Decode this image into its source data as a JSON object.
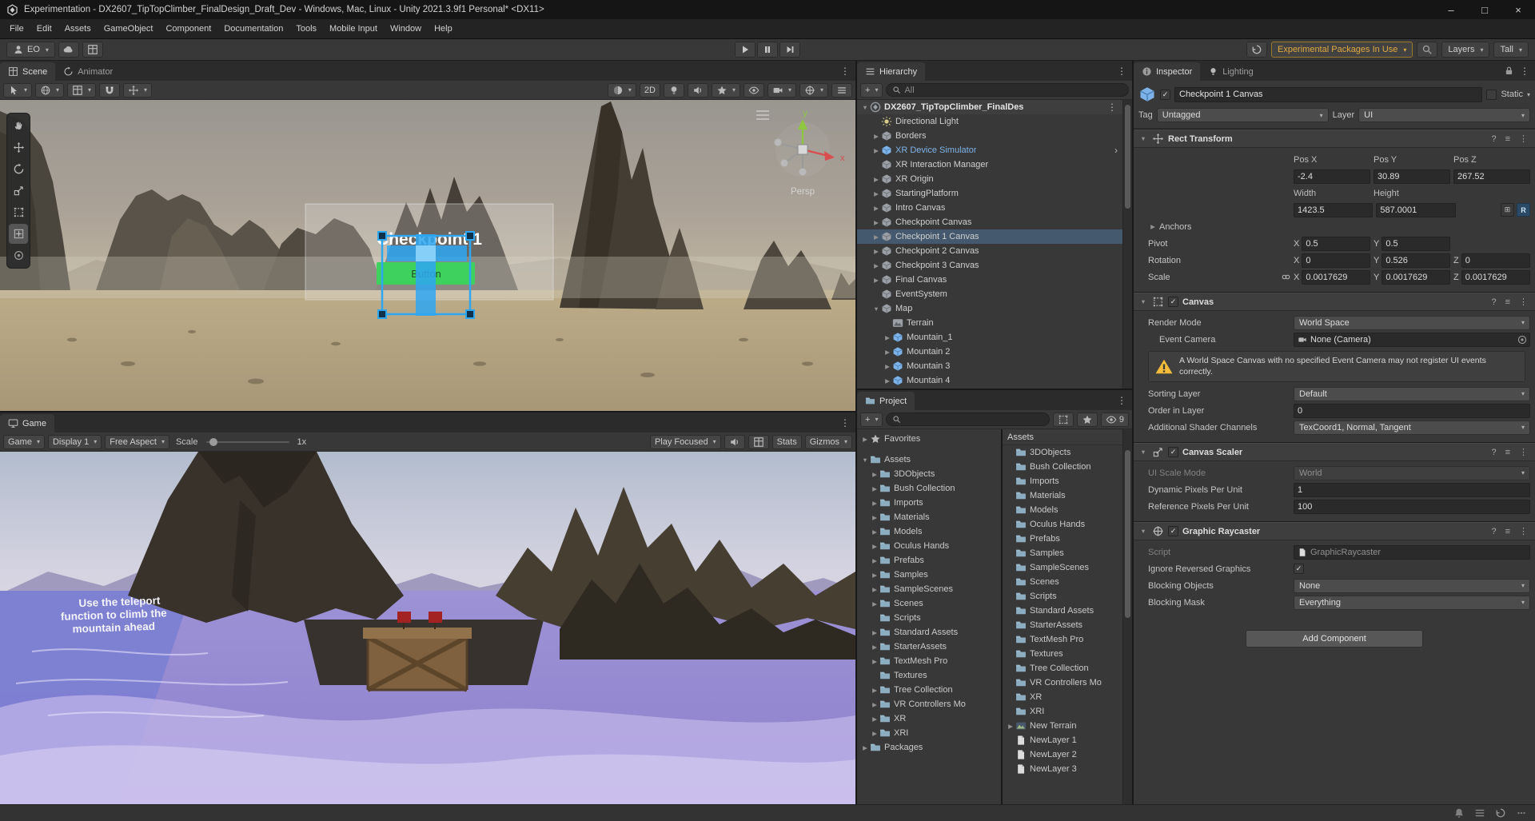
{
  "colors": {
    "selection_blue": "#44596E",
    "prefab_text": "#7FB3E8",
    "warning_yellow": "#F4BC3A",
    "experimental_orange": "#E0A93F",
    "gizmo_blue": "#2EA7F2",
    "button_green": "#3FD15E"
  },
  "title_bar": {
    "title": "Experimentation - DX2607_TipTopClimber_FinalDesign_Draft_Dev - Windows, Mac, Linux - Unity 2021.3.9f1 Personal* <DX11>"
  },
  "menu_bar": [
    "File",
    "Edit",
    "Assets",
    "GameObject",
    "Component",
    "Documentation",
    "Tools",
    "Mobile Input",
    "Window",
    "Help"
  ],
  "main_toolbar": {
    "account_label": "EO",
    "packages_button": "Experimental Packages In Use",
    "layers_button": "Layers",
    "layout_button": "Tall"
  },
  "scene_view": {
    "tab_scene": "Scene",
    "tab_animator": "Animator",
    "toolbar": {
      "two_d": "2D"
    },
    "gizmo": {
      "persp": "Persp",
      "axis_x": "x",
      "axis_y": "y"
    },
    "world_canvas": {
      "title": "Checkpoint 1",
      "button_label": "Button"
    }
  },
  "game_view": {
    "tab_game": "Game",
    "toolbar": {
      "mode": "Game",
      "display": "Display 1",
      "aspect": "Free Aspect",
      "scale_label": "Scale",
      "scale_value": "1x",
      "focus": "Play Focused",
      "stats": "Stats",
      "gizmos": "Gizmos"
    },
    "overlay_text": [
      "Use the teleport",
      "function to climb the",
      "mountain ahead"
    ]
  },
  "hierarchy": {
    "tab": "Hierarchy",
    "search_placeholder": "All",
    "scene_root": "DX2607_TipTopClimber_FinalDes",
    "items": [
      {
        "label": "Directional Light",
        "icon": "light",
        "indent": 1,
        "arrow": false
      },
      {
        "label": "Borders",
        "icon": "cube",
        "indent": 1,
        "arrow": true
      },
      {
        "label": "XR Device Simulator",
        "icon": "prefab",
        "indent": 1,
        "arrow": true,
        "prefab": true,
        "chevron": true
      },
      {
        "label": "XR Interaction Manager",
        "icon": "cube",
        "indent": 1,
        "arrow": false
      },
      {
        "label": "XR Origin",
        "icon": "cube",
        "indent": 1,
        "arrow": true
      },
      {
        "label": "StartingPlatform",
        "icon": "cube",
        "indent": 1,
        "arrow": true
      },
      {
        "label": "Intro Canvas",
        "icon": "cube",
        "indent": 1,
        "arrow": true
      },
      {
        "label": "Checkpoint Canvas",
        "icon": "cube",
        "indent": 1,
        "arrow": true
      },
      {
        "label": "Checkpoint 1 Canvas",
        "icon": "cube",
        "indent": 1,
        "arrow": true,
        "selected": true
      },
      {
        "label": "Checkpoint 2 Canvas",
        "icon": "cube",
        "indent": 1,
        "arrow": true
      },
      {
        "label": "Checkpoint 3 Canvas",
        "icon": "cube",
        "indent": 1,
        "arrow": true
      },
      {
        "label": "Final Canvas",
        "icon": "cube",
        "indent": 1,
        "arrow": true
      },
      {
        "label": "EventSystem",
        "icon": "cube",
        "indent": 1,
        "arrow": false
      },
      {
        "label": "Map",
        "icon": "cube",
        "indent": 1,
        "arrow": true,
        "expanded": true
      },
      {
        "label": "Terrain",
        "icon": "terrain",
        "indent": 2,
        "arrow": false
      },
      {
        "label": "Mountain_1",
        "icon": "prefab",
        "indent": 2,
        "arrow": true
      },
      {
        "label": "Mountain 2",
        "icon": "prefab",
        "indent": 2,
        "arrow": true
      },
      {
        "label": "Mountain 3",
        "icon": "prefab",
        "indent": 2,
        "arrow": true
      },
      {
        "label": "Mountain 4",
        "icon": "prefab",
        "indent": 2,
        "arrow": true
      }
    ]
  },
  "project": {
    "tab": "Project",
    "favorites": {
      "label": "Favorites"
    },
    "hidden_count": "9",
    "tree": [
      {
        "label": "Assets",
        "indent": 0,
        "arrow": true,
        "expanded": true
      },
      {
        "label": "3DObjects",
        "indent": 1,
        "arrow": true
      },
      {
        "label": "Bush Collection",
        "indent": 1,
        "arrow": true
      },
      {
        "label": "Imports",
        "indent": 1,
        "arrow": true
      },
      {
        "label": "Materials",
        "indent": 1,
        "arrow": true
      },
      {
        "label": "Models",
        "indent": 1,
        "arrow": true
      },
      {
        "label": "Oculus Hands",
        "indent": 1,
        "arrow": true
      },
      {
        "label": "Prefabs",
        "indent": 1,
        "arrow": true
      },
      {
        "label": "Samples",
        "indent": 1,
        "arrow": true
      },
      {
        "label": "SampleScenes",
        "indent": 1,
        "arrow": true
      },
      {
        "label": "Scenes",
        "indent": 1,
        "arrow": true
      },
      {
        "label": "Scripts",
        "indent": 1,
        "arrow": false
      },
      {
        "label": "Standard Assets",
        "indent": 1,
        "arrow": true
      },
      {
        "label": "StarterAssets",
        "indent": 1,
        "arrow": true
      },
      {
        "label": "TextMesh Pro",
        "indent": 1,
        "arrow": true
      },
      {
        "label": "Textures",
        "indent": 1,
        "arrow": false
      },
      {
        "label": "Tree Collection",
        "indent": 1,
        "arrow": true
      },
      {
        "label": "VR Controllers Mo",
        "indent": 1,
        "arrow": true
      },
      {
        "label": "XR",
        "indent": 1,
        "arrow": true
      },
      {
        "label": "XRI",
        "indent": 1,
        "arrow": true
      },
      {
        "label": "Packages",
        "indent": 0,
        "arrow": true
      }
    ],
    "contents_header": "Assets",
    "contents": [
      {
        "label": "3DObjects",
        "icon": "folder"
      },
      {
        "label": "Bush Collection",
        "icon": "folder"
      },
      {
        "label": "Imports",
        "icon": "folder"
      },
      {
        "label": "Materials",
        "icon": "folder"
      },
      {
        "label": "Models",
        "icon": "folder"
      },
      {
        "label": "Oculus Hands",
        "icon": "folder"
      },
      {
        "label": "Prefabs",
        "icon": "folder"
      },
      {
        "label": "Samples",
        "icon": "folder"
      },
      {
        "label": "SampleScenes",
        "icon": "folder"
      },
      {
        "label": "Scenes",
        "icon": "folder"
      },
      {
        "label": "Scripts",
        "icon": "folder"
      },
      {
        "label": "Standard Assets",
        "icon": "folder"
      },
      {
        "label": "StarterAssets",
        "icon": "folder"
      },
      {
        "label": "TextMesh Pro",
        "icon": "folder"
      },
      {
        "label": "Textures",
        "icon": "folder"
      },
      {
        "label": "Tree Collection",
        "icon": "folder"
      },
      {
        "label": "VR Controllers Mo",
        "icon": "folder"
      },
      {
        "label": "XR",
        "icon": "folder"
      },
      {
        "label": "XRI",
        "icon": "folder"
      },
      {
        "label": "New Terrain",
        "icon": "terrain-asset",
        "arrow": true
      },
      {
        "label": "NewLayer 1",
        "icon": "file"
      },
      {
        "label": "NewLayer 2",
        "icon": "file"
      },
      {
        "label": "NewLayer 3",
        "icon": "file"
      }
    ]
  },
  "inspector": {
    "tab_inspector": "Inspector",
    "tab_lighting": "Lighting",
    "header_name": "Checkpoint 1 Canvas",
    "static_label": "Static",
    "tag_label": "Tag",
    "tag_value": "Untagged",
    "layer_label": "Layer",
    "layer_value": "UI",
    "rect_transform": {
      "title": "Rect Transform",
      "h_pos_x": "Pos X",
      "h_pos_y": "Pos Y",
      "h_pos_z": "Pos Z",
      "pos_x": "-2.4",
      "pos_y": "30.89",
      "pos_z": "267.52",
      "h_width": "Width",
      "h_height": "Height",
      "width": "1423.5",
      "height": "587.0001",
      "anchors_label": "Anchors",
      "pivot_label": "Pivot",
      "x_label": "X",
      "y_label": "Y",
      "z_label": "Z",
      "pivot_x": "0.5",
      "pivot_y": "0.5",
      "rotation_label": "Rotation",
      "rot_x": "0",
      "rot_y": "0.526",
      "rot_z": "0",
      "scale_label": "Scale",
      "scale_x": "0.0017629",
      "scale_y": "0.0017629",
      "scale_z": "0.0017629",
      "raycast_r": "R"
    },
    "canvas": {
      "title": "Canvas",
      "render_mode_label": "Render Mode",
      "render_mode": "World Space",
      "event_camera_label": "Event Camera",
      "event_camera": "None (Camera)",
      "warning": "A World Space Canvas with no specified Event Camera may not register UI events correctly.",
      "sorting_layer_label": "Sorting Layer",
      "sorting_layer": "Default",
      "order_label": "Order in Layer",
      "order": "0",
      "shader_channels_label": "Additional Shader Channels",
      "shader_channels": "TexCoord1, Normal, Tangent"
    },
    "canvas_scaler": {
      "title": "Canvas Scaler",
      "ui_scale_mode_label": "UI Scale Mode",
      "ui_scale_mode": "World",
      "dynamic_ppu_label": "Dynamic Pixels Per Unit",
      "dynamic_ppu": "1",
      "reference_ppu_label": "Reference Pixels Per Unit",
      "reference_ppu": "100"
    },
    "graphic_raycaster": {
      "title": "Graphic Raycaster",
      "script_label": "Script",
      "script_value": "GraphicRaycaster",
      "ignore_reversed_label": "Ignore Reversed Graphics",
      "blocking_objects_label": "Blocking Objects",
      "blocking_objects": "None",
      "blocking_mask_label": "Blocking Mask",
      "blocking_mask": "Everything"
    },
    "add_component": "Add Component"
  }
}
